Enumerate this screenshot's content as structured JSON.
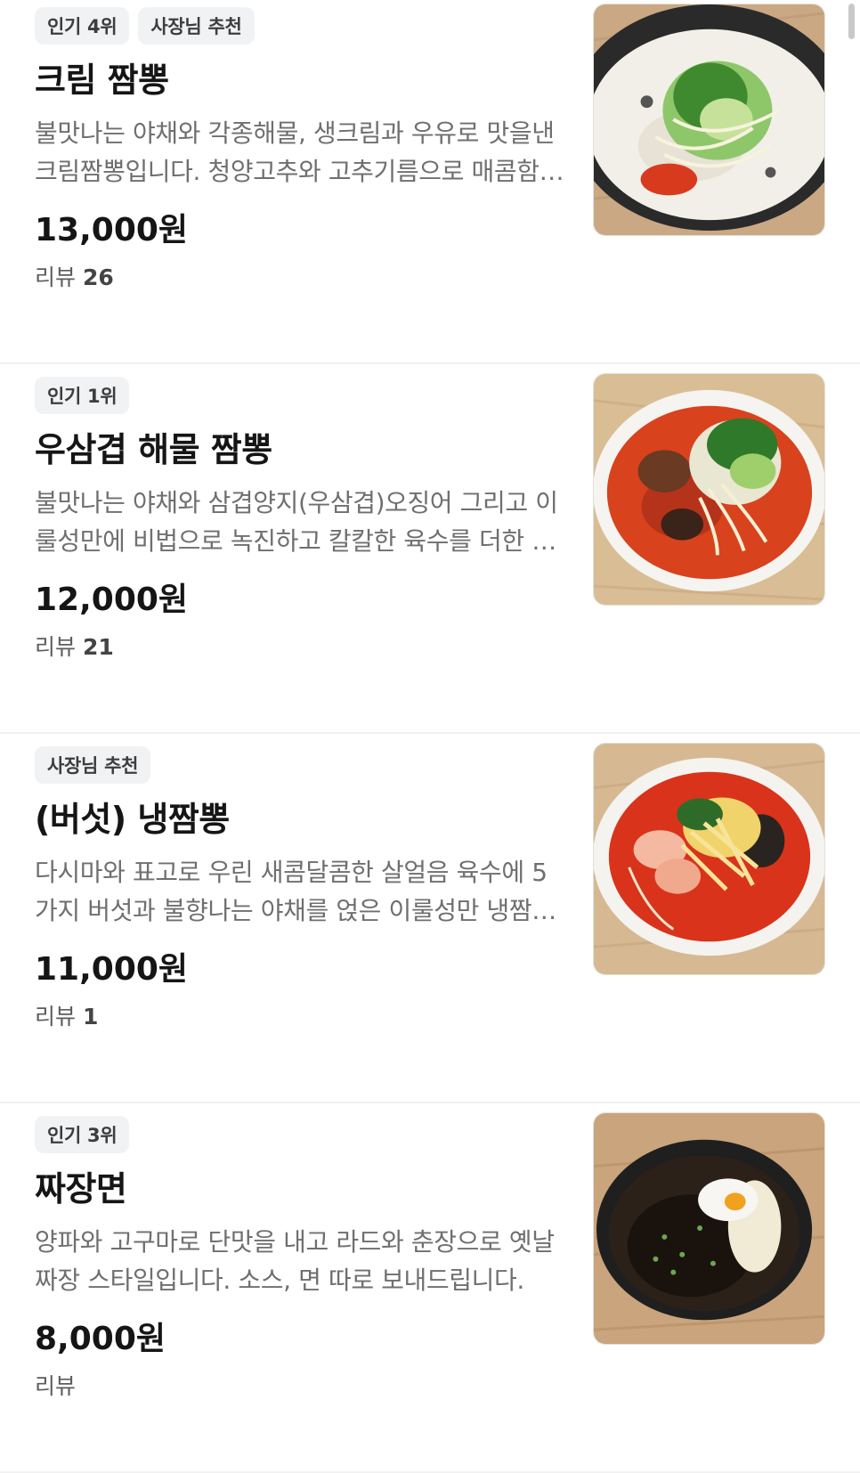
{
  "menu": [
    {
      "badges": [
        "인기 4위",
        "사장님 추천"
      ],
      "name": "크림 짬뽕",
      "description": "불맛나는 야채와 각종해물, 생크림과 우유로 맛을낸 크림짬뽕입니다. 청양고추와 고추기름으로 매콤함을 더했습니다.",
      "price": "13,000원",
      "review_label": "리뷰",
      "review_count": "26",
      "image": "cream-jjamppong-photo"
    },
    {
      "badges": [
        "인기 1위"
      ],
      "name": "우삼겹 해물 짬뽕",
      "description": "불맛나는 야채와 삼겹양지(우삼겹)오징어 그리고 이룰성만에 비법으로 녹진하고 칼칼한 육수를 더한 짬뽕입니다.",
      "price": "12,000원",
      "review_label": "리뷰",
      "review_count": "21",
      "image": "beef-seafood-jjamppong-photo"
    },
    {
      "badges": [
        "사장님 추천"
      ],
      "name": "(버섯) 냉짬뽕",
      "description": "다시마와 표고로 우린 새콤달콤한 살얼음 육수에 5가지 버섯과 불향나는 야채를 얹은 이룰성만 냉짬뽕입니다.",
      "price": "11,000원",
      "review_label": "리뷰",
      "review_count": "1",
      "image": "cold-mushroom-jjamppong-photo"
    },
    {
      "badges": [
        "인기 3위"
      ],
      "name": "짜장면",
      "description": "양파와 고구마로 단맛을 내고 라드와 춘장으로 옛날짜장 스타일입니다. 소스, 면 따로 보내드립니다.",
      "price": "8,000원",
      "review_label": "리뷰",
      "review_count": "",
      "image": "jjajangmyeon-photo"
    }
  ]
}
